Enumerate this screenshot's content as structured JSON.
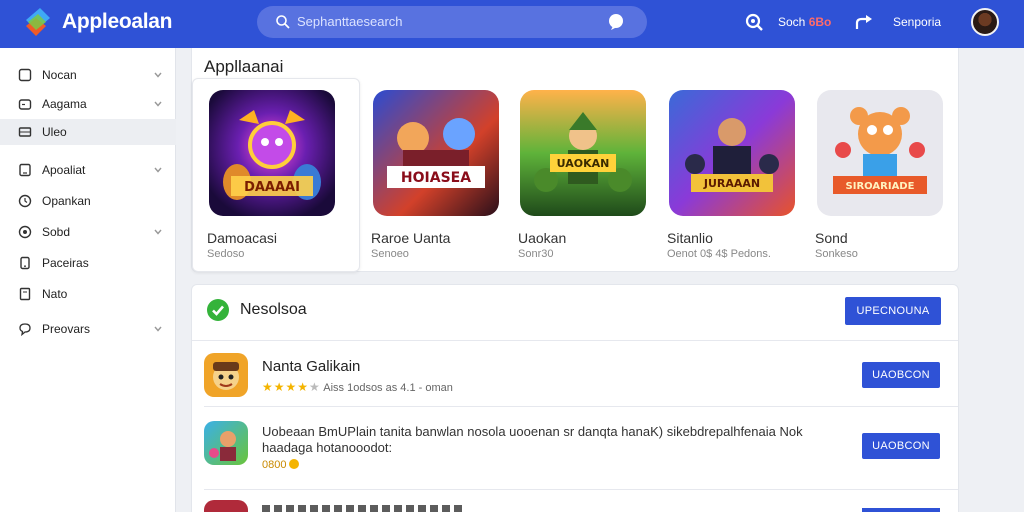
{
  "header": {
    "brand": "Appleoalan",
    "search_placeholder": "Sephanttaesearch",
    "item1_prefix": "Soch",
    "item1_highlight": "6Bo",
    "item2_label": "Senporia",
    "icons": [
      "app-logo-icon",
      "search-icon",
      "voice-icon",
      "notification-search-icon",
      "share-icon"
    ]
  },
  "sidebar": {
    "items": [
      {
        "label": "Nocan",
        "icon": "square-icon",
        "chevron": true
      },
      {
        "label": "Aagama",
        "icon": "gamepad-icon",
        "chevron": true
      },
      {
        "label": "Uleo",
        "icon": "list-icon",
        "chevron": false,
        "active": true
      },
      {
        "label": "Apoaliat",
        "icon": "tablet-icon",
        "chevron": true
      },
      {
        "label": "Opankan",
        "icon": "clock-icon",
        "chevron": false
      },
      {
        "label": "Sobd",
        "icon": "circle-icon",
        "chevron": true
      },
      {
        "label": "Paceiras",
        "icon": "phone-icon",
        "chevron": false
      },
      {
        "label": "Nato",
        "icon": "book-icon",
        "chevron": false
      },
      {
        "label": "Preovars",
        "icon": "bubble-icon",
        "chevron": true
      }
    ]
  },
  "featured": {
    "title": "Appllaanai",
    "apps": [
      {
        "name": "Damoacasi",
        "sub": "Sedoso",
        "art_text": "DAAAAI"
      },
      {
        "name": "Raroe Uanta",
        "sub": "Senoeo",
        "art_text": "HOIASEA"
      },
      {
        "name": "Uaokan",
        "sub": "Sonr30",
        "art_text": "UAOKAN"
      },
      {
        "name": "Sitanlio",
        "sub": "Oenot 0$ 4$ Pedons.",
        "art_text": "JURAAAN"
      },
      {
        "name": "Sond",
        "sub": "Sonkeso",
        "art_text": "SIROARIADE"
      }
    ]
  },
  "list": {
    "title": "Nesolsoa",
    "main_button": "UPECNOUNA",
    "rows": [
      {
        "name": "Nanta Galikain",
        "stars_filled": 4,
        "stars_total": 5,
        "meta": "Aiss 1odsos as 4.1 - oman",
        "button": "UAOBCON"
      },
      {
        "description": "Uobeaan BmUPlain tanita banwlan nosola uooenan sr danqta hanaK) sikebdrepalhfenaia Nok haadaga hotanooodot:",
        "price": "0800",
        "button": "UAOBCON"
      }
    ]
  },
  "colors": {
    "header": "#2f52d6",
    "accent": "#2f52d6",
    "star": "#f4b400",
    "check": "#34b33a"
  }
}
